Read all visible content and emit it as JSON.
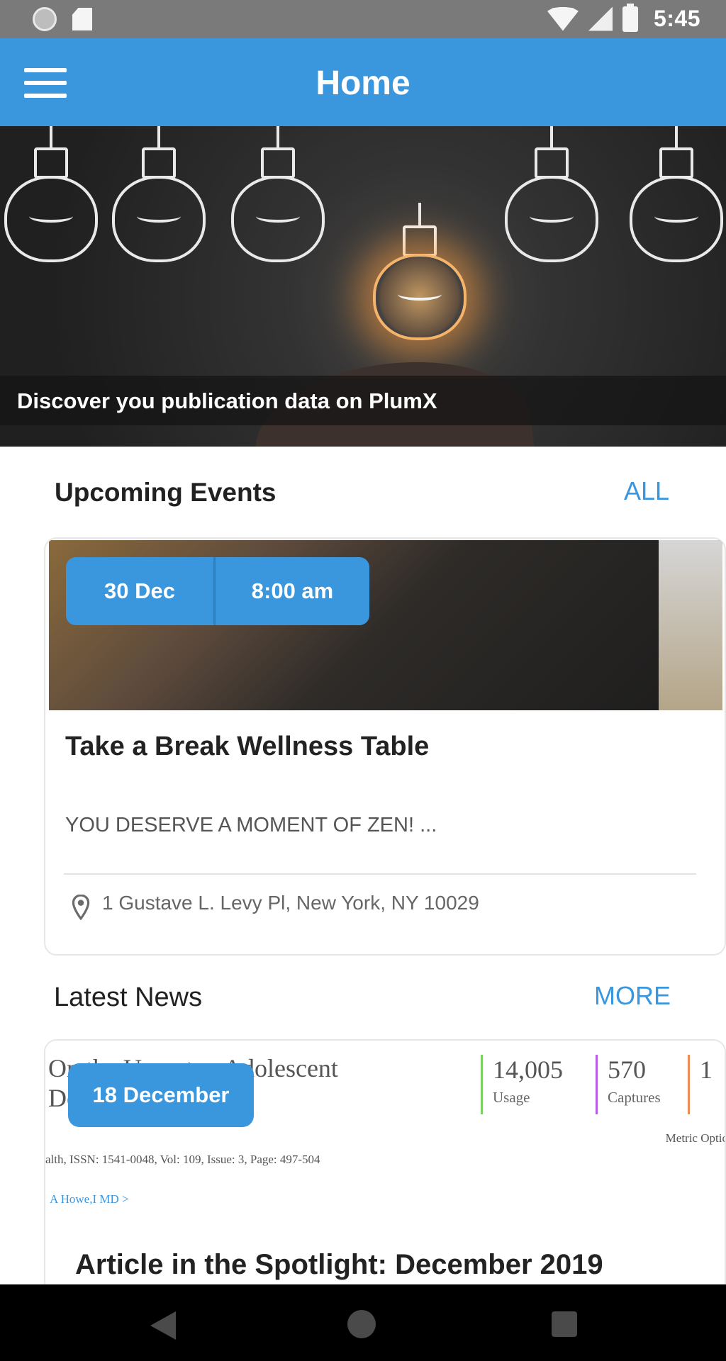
{
  "status_bar": {
    "time": "5:45",
    "icons": [
      "notification-dot-icon",
      "sd-card-icon",
      "wifi-icon",
      "signal-icon",
      "battery-icon"
    ]
  },
  "app_bar": {
    "title": "Home",
    "menu_icon": "hamburger-menu-icon"
  },
  "hero": {
    "caption": "Discover you publication data on PlumX"
  },
  "events": {
    "title": "Upcoming Events",
    "action": "ALL",
    "card": {
      "date": "30 Dec",
      "time": "8:00 am",
      "title": "Take a Break Wellness Table",
      "description": "YOU DESERVE A MOMENT OF ZEN! ...",
      "location": "1 Gustave L. Levy Pl, New York, NY 10029",
      "location_icon": "location-pin-icon"
    }
  },
  "news": {
    "title": "Latest News",
    "action": "MORE",
    "card": {
      "date": "18 December",
      "image_headline_line1": "On the Unmet ... Adolescent",
      "image_headline_line2": "Do ... Affect",
      "metrics": [
        {
          "value": "14,005",
          "label": "Usage",
          "color": "#7ccf62"
        },
        {
          "value": "570",
          "label": "Captures",
          "color": "#b65ce5"
        },
        {
          "value": "1",
          "label": "",
          "color": "#f08a55"
        }
      ],
      "metric_options": "Metric Optic",
      "journal_info": "alth, ISSN: 1541-0048, Vol: 109, Issue: 3, Page: 497-504",
      "author_link": "A Howe,I MD >",
      "title": "Article in the Spotlight: December 2019"
    }
  },
  "navigation_bar": {
    "icons": [
      "back-icon",
      "home-icon",
      "overview-icon"
    ]
  },
  "colors": {
    "primary_blue": "#3a96dd",
    "status_bar": "#7a7a7a",
    "nav_bar": "#000000",
    "text_dark": "#222222",
    "text_muted": "#666666"
  }
}
